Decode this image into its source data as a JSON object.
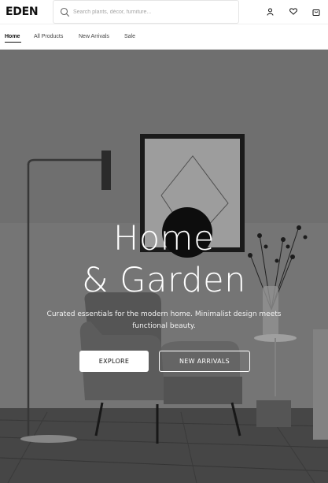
{
  "brand": {
    "logo": "EDEN"
  },
  "search": {
    "placeholder": "Search plants, décor, furniture..."
  },
  "header_icons": [
    "user-icon",
    "heart-icon",
    "shopping-bag-icon"
  ],
  "nav": {
    "items": [
      {
        "label": "Home",
        "active": true
      },
      {
        "label": "All Products",
        "active": false
      },
      {
        "label": "New Arrivals",
        "active": false
      },
      {
        "label": "Sale",
        "active": false
      }
    ]
  },
  "hero": {
    "title_line1": "Home",
    "title_line2": "& Garden",
    "subtitle": "Curated essentials for the modern home. Minimalist design meets functional beauty.",
    "explore_label": "EXPLORE",
    "new_arrivals_label": "NEW ARRIVALS"
  },
  "colors": {
    "accent": "#111111",
    "background": "#ffffff",
    "hero_overlay": "#7a7a7a"
  }
}
